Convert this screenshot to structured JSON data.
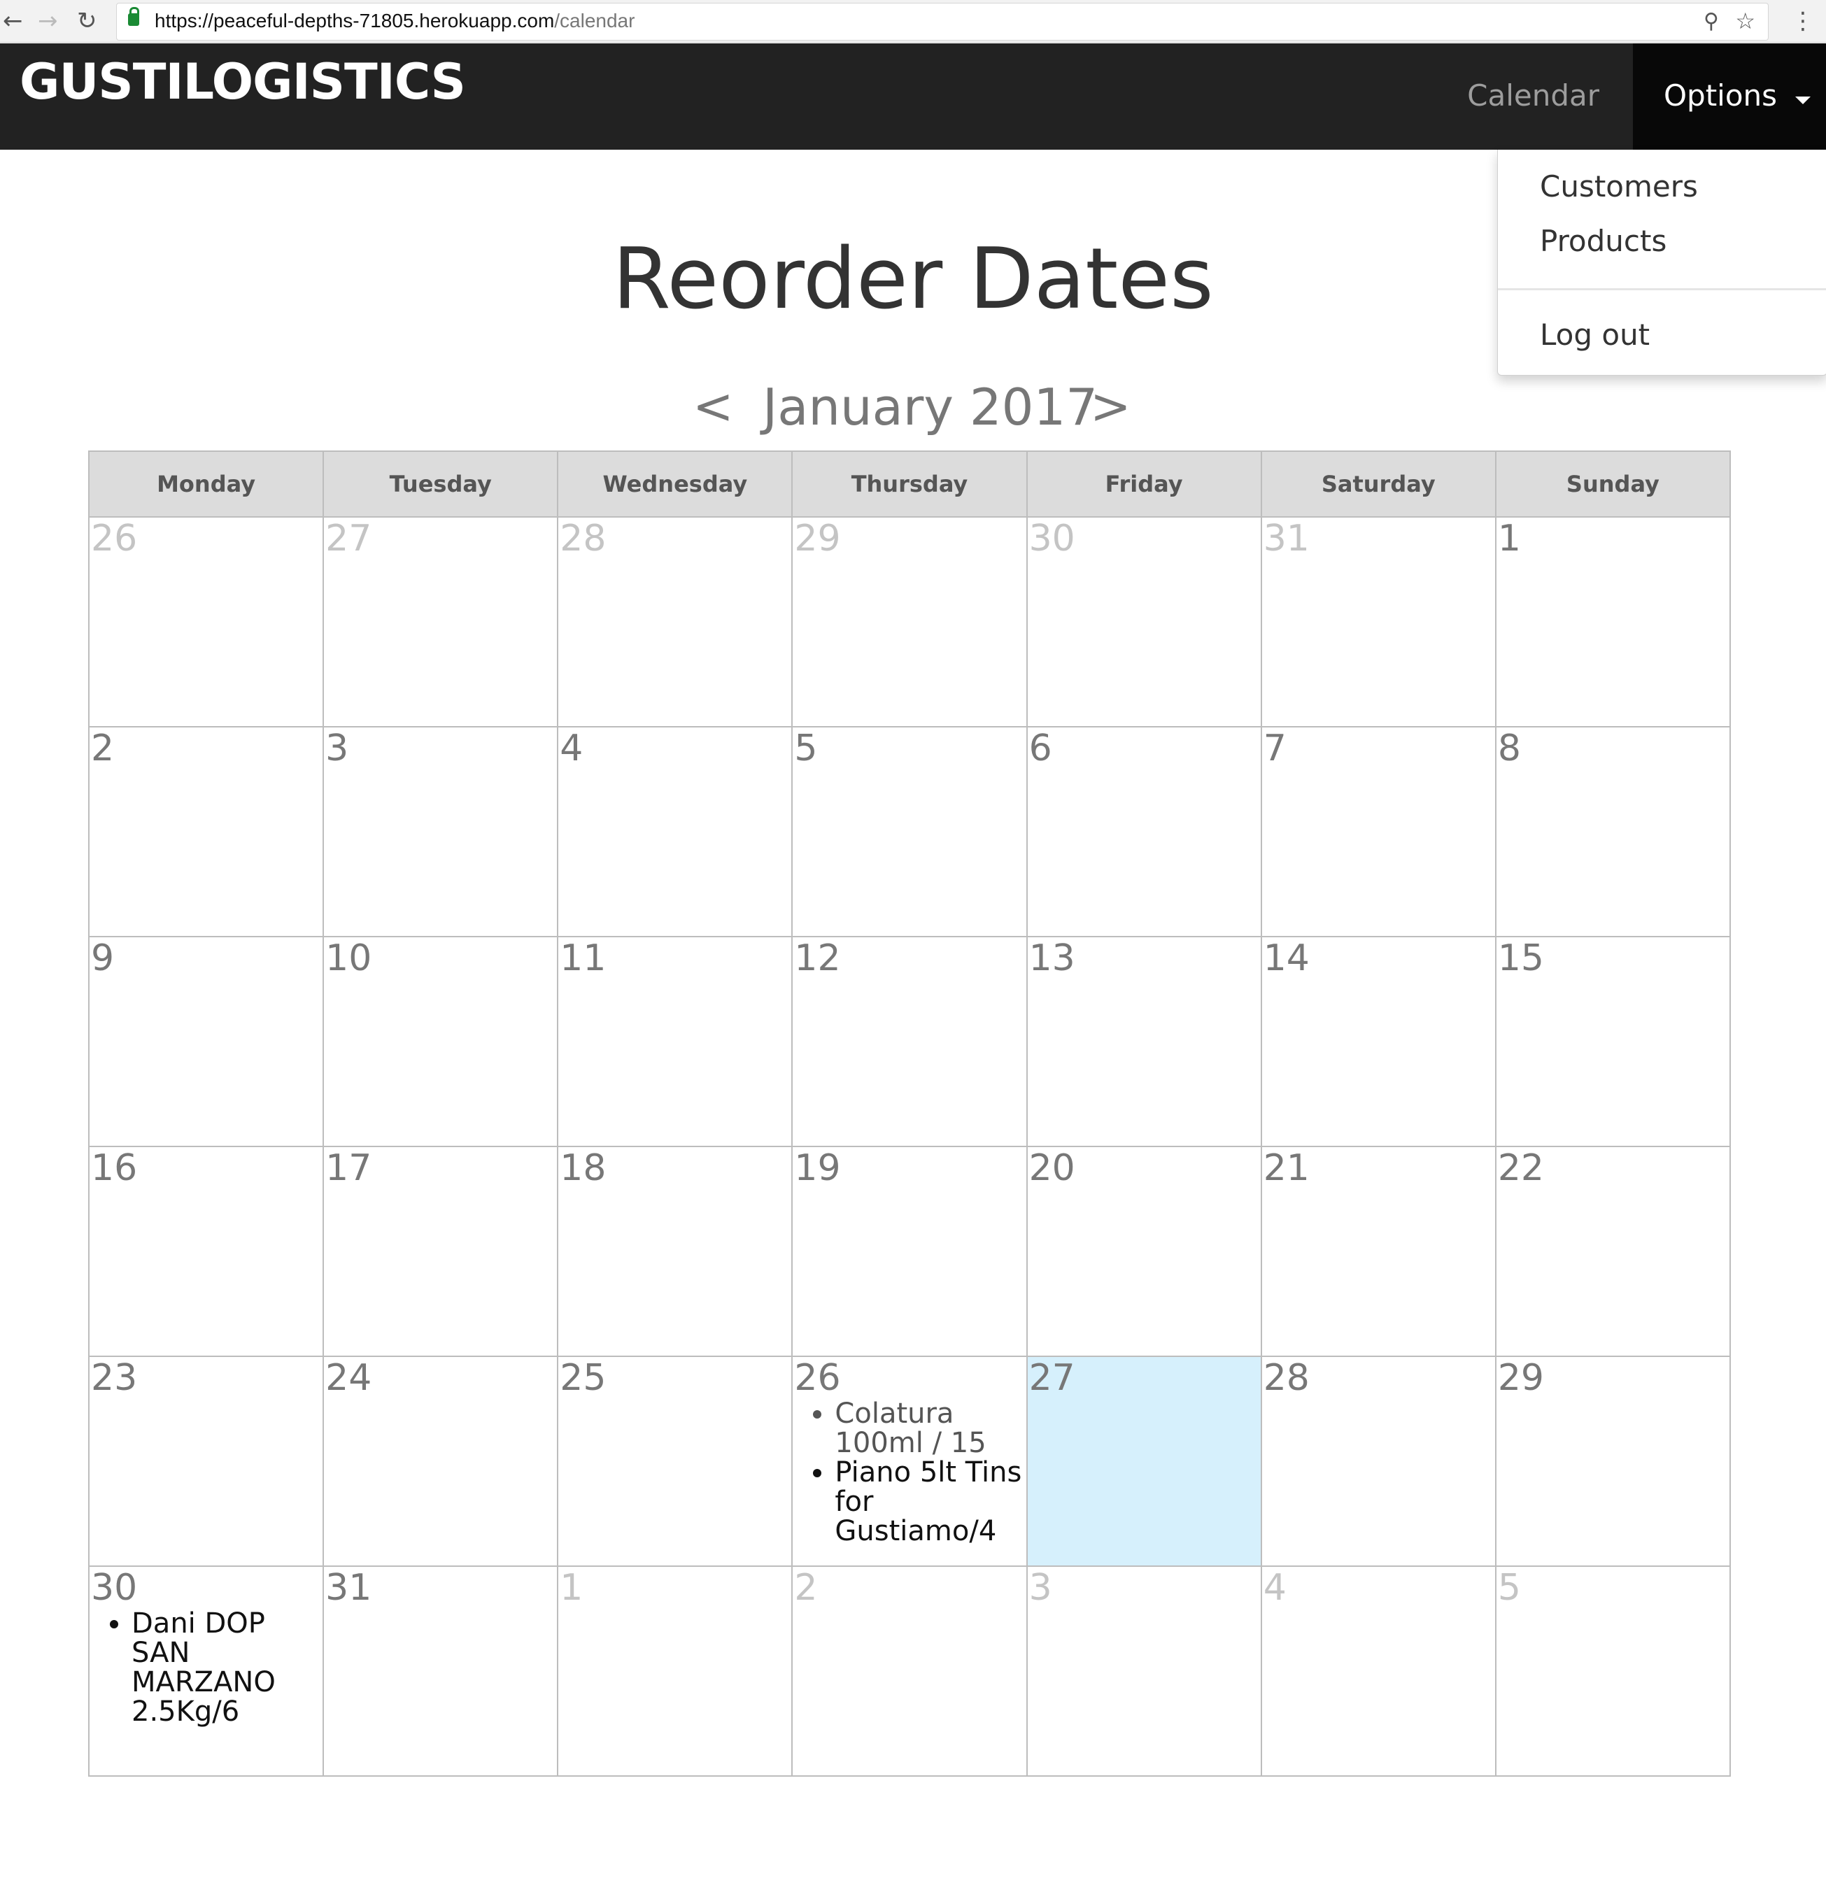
{
  "browser": {
    "url_host": "https://peaceful-depths-71805.herokuapp.com",
    "url_path": "/calendar"
  },
  "navbar": {
    "brand": "GUSTILOGISTICS",
    "calendar_link": "Calendar",
    "options_label": "Options"
  },
  "dropdown": {
    "items": [
      "Customers",
      "Products",
      "Log out"
    ]
  },
  "page": {
    "title": "Reorder Dates",
    "prev": "<",
    "next": ">",
    "month_label": "January 2017"
  },
  "calendar": {
    "weekdays": [
      "Monday",
      "Tuesday",
      "Wednesday",
      "Thursday",
      "Friday",
      "Saturday",
      "Sunday"
    ],
    "weeks": [
      [
        {
          "day": "26",
          "other": true
        },
        {
          "day": "27",
          "other": true
        },
        {
          "day": "28",
          "other": true
        },
        {
          "day": "29",
          "other": true
        },
        {
          "day": "30",
          "other": true
        },
        {
          "day": "31",
          "other": true
        },
        {
          "day": "1"
        }
      ],
      [
        {
          "day": "2"
        },
        {
          "day": "3"
        },
        {
          "day": "4"
        },
        {
          "day": "5"
        },
        {
          "day": "6"
        },
        {
          "day": "7"
        },
        {
          "day": "8"
        }
      ],
      [
        {
          "day": "9"
        },
        {
          "day": "10"
        },
        {
          "day": "11"
        },
        {
          "day": "12"
        },
        {
          "day": "13"
        },
        {
          "day": "14"
        },
        {
          "day": "15"
        }
      ],
      [
        {
          "day": "16"
        },
        {
          "day": "17"
        },
        {
          "day": "18"
        },
        {
          "day": "19"
        },
        {
          "day": "20"
        },
        {
          "day": "21"
        },
        {
          "day": "22"
        }
      ],
      [
        {
          "day": "23"
        },
        {
          "day": "24"
        },
        {
          "day": "25"
        },
        {
          "day": "26",
          "events": [
            "Colatura 100ml / 15",
            "Piano 5lt Tins for Gustiamo/4"
          ]
        },
        {
          "day": "27",
          "today": true
        },
        {
          "day": "28"
        },
        {
          "day": "29"
        }
      ],
      [
        {
          "day": "30",
          "events": [
            "Dani DOP SAN MARZANO 2.5Kg/6"
          ]
        },
        {
          "day": "31"
        },
        {
          "day": "1",
          "other": true
        },
        {
          "day": "2",
          "other": true
        },
        {
          "day": "3",
          "other": true
        },
        {
          "day": "4",
          "other": true
        },
        {
          "day": "5",
          "other": true
        }
      ]
    ]
  }
}
